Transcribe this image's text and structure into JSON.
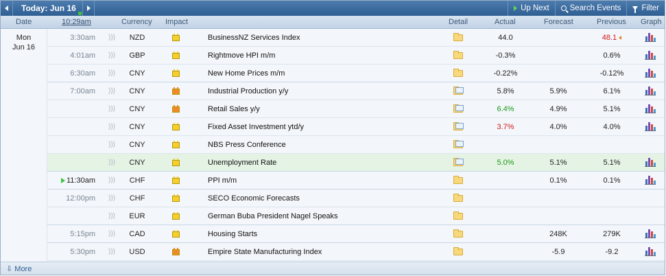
{
  "nav": {
    "today_label": "Today: Jun 16",
    "up_next": "Up Next",
    "search_events": "Search Events",
    "filter": "Filter"
  },
  "columns": {
    "date": "Date",
    "time": "10:29am",
    "currency": "Currency",
    "impact": "Impact",
    "detail": "Detail",
    "actual": "Actual",
    "forecast": "Forecast",
    "previous": "Previous",
    "graph": "Graph"
  },
  "date": {
    "weekday": "Mon",
    "day": "Jun 16"
  },
  "colors": {
    "impact_medium": "#f5cf2a",
    "impact_high": "#f08a24",
    "better": "#1a9a1a",
    "worse": "#d11a1a",
    "neutral": "#222222"
  },
  "rows": [
    {
      "time": "3:30am",
      "currency": "NZD",
      "impact": "medium",
      "event": "BusinessNZ Services Index",
      "detail_icon": "folder-icon",
      "actual": "44.0",
      "actual_status": "neutral",
      "forecast": "",
      "previous": "48.1",
      "previous_status": "worse",
      "revised": true,
      "graph": true
    },
    {
      "time": "4:01am",
      "currency": "GBP",
      "impact": "medium",
      "event": "Rightmove HPI m/m",
      "detail_icon": "folder-icon",
      "actual": "-0.3%",
      "actual_status": "neutral",
      "forecast": "",
      "previous": "0.6%",
      "previous_status": "neutral",
      "revised": false,
      "graph": true
    },
    {
      "time": "6:30am",
      "currency": "CNY",
      "impact": "medium",
      "event": "New Home Prices m/m",
      "detail_icon": "folder-icon",
      "actual": "-0.22%",
      "actual_status": "neutral",
      "forecast": "",
      "previous": "-0.12%",
      "previous_status": "neutral",
      "revised": false,
      "graph": true
    },
    {
      "time": "7:00am",
      "currency": "CNY",
      "impact": "high",
      "event": "Industrial Production y/y",
      "detail_icon": "folder-open-icon",
      "actual": "5.8%",
      "actual_status": "neutral",
      "forecast": "5.9%",
      "previous": "6.1%",
      "previous_status": "neutral",
      "revised": false,
      "graph": true
    },
    {
      "time": "",
      "currency": "CNY",
      "impact": "high",
      "event": "Retail Sales y/y",
      "detail_icon": "folder-open-icon",
      "actual": "6.4%",
      "actual_status": "better",
      "forecast": "4.9%",
      "previous": "5.1%",
      "previous_status": "neutral",
      "revised": false,
      "graph": true
    },
    {
      "time": "",
      "currency": "CNY",
      "impact": "medium",
      "event": "Fixed Asset Investment ytd/y",
      "detail_icon": "folder-open-icon",
      "actual": "3.7%",
      "actual_status": "worse",
      "forecast": "4.0%",
      "previous": "4.0%",
      "previous_status": "neutral",
      "revised": false,
      "graph": true
    },
    {
      "time": "",
      "currency": "CNY",
      "impact": "medium",
      "event": "NBS Press Conference",
      "detail_icon": "folder-open-icon",
      "actual": "",
      "actual_status": "neutral",
      "forecast": "",
      "previous": "",
      "previous_status": "neutral",
      "revised": false,
      "graph": false
    },
    {
      "time": "",
      "currency": "CNY",
      "impact": "medium",
      "event": "Unemployment Rate",
      "detail_icon": "folder-open-icon",
      "actual": "5.0%",
      "actual_status": "better",
      "forecast": "5.1%",
      "previous": "5.1%",
      "previous_status": "neutral",
      "revised": false,
      "graph": true,
      "highlight": true
    },
    {
      "time": "11:30am",
      "currency": "CHF",
      "impact": "medium",
      "event": "PPI m/m",
      "detail_icon": "folder-icon",
      "actual": "",
      "actual_status": "neutral",
      "forecast": "0.1%",
      "previous": "0.1%",
      "previous_status": "neutral",
      "revised": false,
      "graph": true,
      "now": true
    },
    {
      "time": "12:00pm",
      "currency": "CHF",
      "impact": "medium",
      "event": "SECO Economic Forecasts",
      "detail_icon": "folder-icon",
      "actual": "",
      "actual_status": "neutral",
      "forecast": "",
      "previous": "",
      "previous_status": "neutral",
      "revised": false,
      "graph": false
    },
    {
      "time": "",
      "currency": "EUR",
      "impact": "medium",
      "event": "German Buba President Nagel Speaks",
      "detail_icon": "folder-icon",
      "actual": "",
      "actual_status": "neutral",
      "forecast": "",
      "previous": "",
      "previous_status": "neutral",
      "revised": false,
      "graph": false
    },
    {
      "time": "5:15pm",
      "currency": "CAD",
      "impact": "medium",
      "event": "Housing Starts",
      "detail_icon": "folder-icon",
      "actual": "",
      "actual_status": "neutral",
      "forecast": "248K",
      "previous": "279K",
      "previous_status": "neutral",
      "revised": false,
      "graph": true
    },
    {
      "time": "5:30pm",
      "currency": "USD",
      "impact": "high",
      "event": "Empire State Manufacturing Index",
      "detail_icon": "folder-icon",
      "actual": "",
      "actual_status": "neutral",
      "forecast": "-5.9",
      "previous": "-9.2",
      "previous_status": "neutral",
      "revised": false,
      "graph": true
    }
  ],
  "footer": {
    "more": "More"
  }
}
